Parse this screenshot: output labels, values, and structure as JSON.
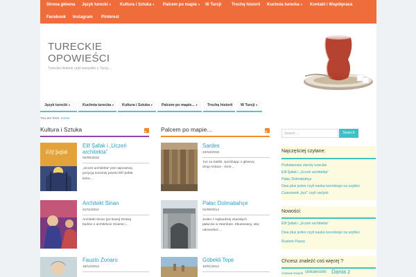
{
  "top_nav": {
    "items": [
      {
        "label": "Strona główna",
        "has_dropdown": false
      },
      {
        "label": "Język turecki",
        "has_dropdown": true
      },
      {
        "label": "Kultura i Sztuka",
        "has_dropdown": true
      },
      {
        "label": "Palcem po mapie",
        "has_dropdown": true
      },
      {
        "label": "W Turcji",
        "has_dropdown": false
      },
      {
        "label": "Trochę historii",
        "has_dropdown": false
      },
      {
        "label": "Kuchnia turecka",
        "has_dropdown": true
      },
      {
        "label": "Kontakt i Współpraca",
        "has_dropdown": false
      },
      {
        "label": "Facebook",
        "has_dropdown": false
      },
      {
        "label": "Instagram",
        "has_dropdown": false
      },
      {
        "label": "Pinterest",
        "has_dropdown": false
      }
    ],
    "bg_color": "#ef6c3b"
  },
  "header": {
    "title_line1": "TURECKIE",
    "title_line2": "OPOWIEŚCI",
    "tagline": "Tureckie historie czyli wszystko o Turcji....",
    "image_icon": "turkish-tea-glass"
  },
  "secondary_nav": {
    "items": [
      {
        "label": "Język turecki",
        "has_dropdown": true
      },
      {
        "label": "Kuchnia turecka",
        "has_dropdown": true
      },
      {
        "label": "Kultura i Sztuka",
        "has_dropdown": true
      },
      {
        "label": "Palcem po mapie...",
        "has_dropdown": true
      },
      {
        "label": "Trochę historii",
        "has_dropdown": false
      },
      {
        "label": "W Turcji",
        "has_dropdown": true
      }
    ],
    "underline_color": "#4fc4cf"
  },
  "breadcrumb": {
    "prefix": "You are here:",
    "home": "Home"
  },
  "columns": [
    {
      "title": "Kultura i Sztuka",
      "accent_color": "#8e44ad",
      "posts": [
        {
          "title": "Elif Şafak i „Uczeń",
          "title_line2": "architekta”",
          "date": "02/06/2016",
          "excerpt": [
            "„Uczeń architekta” jest najnowszą",
            "pozycją tureckiej pisarki Elif Şafak,",
            "która...."
          ]
        },
        {
          "title": "Architekt Sinan",
          "date": "21/11/2014",
          "excerpt": [
            "Architekt Sinan (po lewej) Dzisiaj",
            "będzie o architekcie Sinanie i..."
          ]
        },
        {
          "title": "Fausto Zonaro",
          "date": "18/12/2012",
          "excerpt": []
        }
      ]
    },
    {
      "title": "Palcem po mapie...",
      "accent_color": "#f08a24",
      "posts": [
        {
          "title": "Sardes",
          "date": "23/10/2015",
          "excerpt": [
            "Tuż za Salihli, zjeżdżając z głównej",
            "drogi Ankara - Izmir,..."
          ]
        },
        {
          "title": "Pałac Dolmabahçe",
          "date": "01/09/2014",
          "excerpt": [
            "Jeden z najbardziej okazałych",
            "pałaców w Stambule. Zbudowany, aby",
            "udowodnić...."
          ]
        },
        {
          "title": "Göbekli Tepe",
          "date": "10/01/2012",
          "excerpt": []
        }
      ]
    }
  ],
  "sidebar": {
    "search_placeholder": "Search ...",
    "search_button": "Search",
    "popular": {
      "title": "Najczęściej czytane:",
      "links": [
        "Podstawowe zwroty tureckie",
        "Elif Şafak i „Uczeń architekta”",
        "Pałac Dolmabahçe",
        "Dwa plus jeden czyli nauka tureckiego na szybko",
        "Czasownik „być” czyli var/yok"
      ]
    },
    "news": {
      "title": "Nowości:",
      "links": [
        "Elif Şafak i „Uczeń architekta”",
        "Dwa plus jeden czyli nauka tureckiego na szybko",
        "Rustem Pasza"
      ]
    },
    "more": {
      "title": "Chcesz znaleźć coś więcej ?",
      "tags": [
        "ciekawe książki",
        "ciekawostki",
        "Dania z"
      ]
    },
    "accent_color": "#3cc2c4"
  }
}
